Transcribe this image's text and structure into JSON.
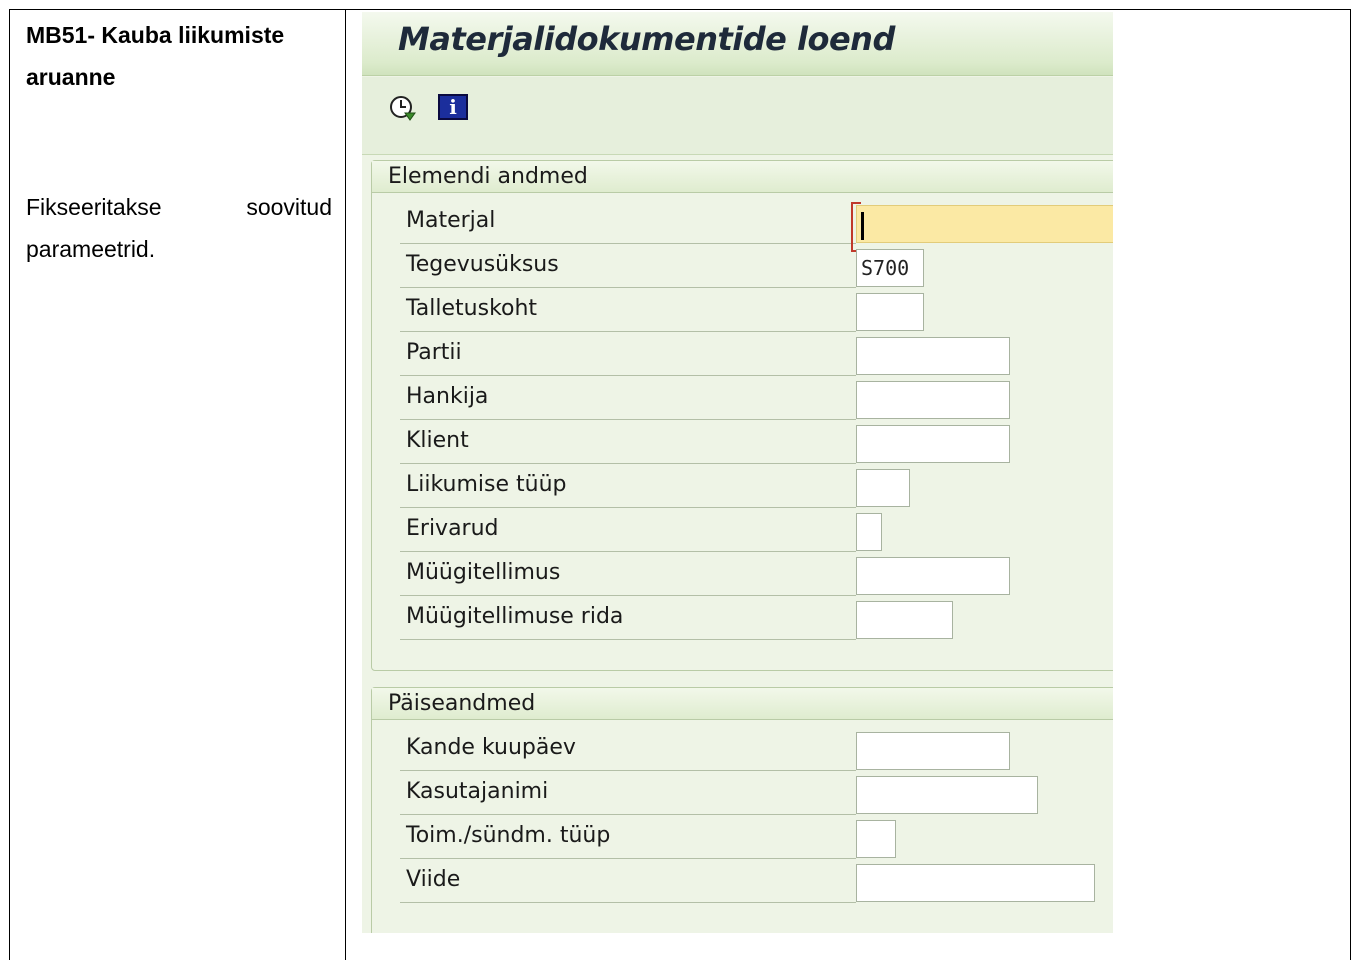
{
  "document": {
    "heading_code": "MB51",
    "heading_rest": "- Kauba liikumiste aruanne",
    "description": "Fikseeritakse soovitud parameetrid."
  },
  "sap": {
    "title": "Materjalidokumentide loend",
    "toolbar": {
      "execute_icon": "execute-clock-icon",
      "info_icon": "information-icon",
      "info_glyph": "i"
    },
    "group1": {
      "title": "Elemendi andmed",
      "fields": [
        {
          "label": "Materjal",
          "value": ""
        },
        {
          "label": "Tegevusüksus",
          "value": "S700"
        },
        {
          "label": "Talletuskoht",
          "value": ""
        },
        {
          "label": "Partii",
          "value": ""
        },
        {
          "label": "Hankija",
          "value": ""
        },
        {
          "label": "Klient",
          "value": ""
        },
        {
          "label": "Liikumise tüüp",
          "value": ""
        },
        {
          "label": "Erivarud",
          "value": ""
        },
        {
          "label": "Müügitellimus",
          "value": ""
        },
        {
          "label": "Müügitellimuse rida",
          "value": ""
        }
      ]
    },
    "group2": {
      "title": "Päiseandmed",
      "fields": [
        {
          "label": "Kande kuupäev",
          "value": ""
        },
        {
          "label": "Kasutajanimi",
          "value": ""
        },
        {
          "label": "Toim./sündm. tüüp",
          "value": ""
        },
        {
          "label": "Viide",
          "value": ""
        }
      ]
    },
    "colors": {
      "background": "#eef4e6",
      "active_field": "#fbe9a4",
      "title_text": "#1e2a3a"
    }
  }
}
